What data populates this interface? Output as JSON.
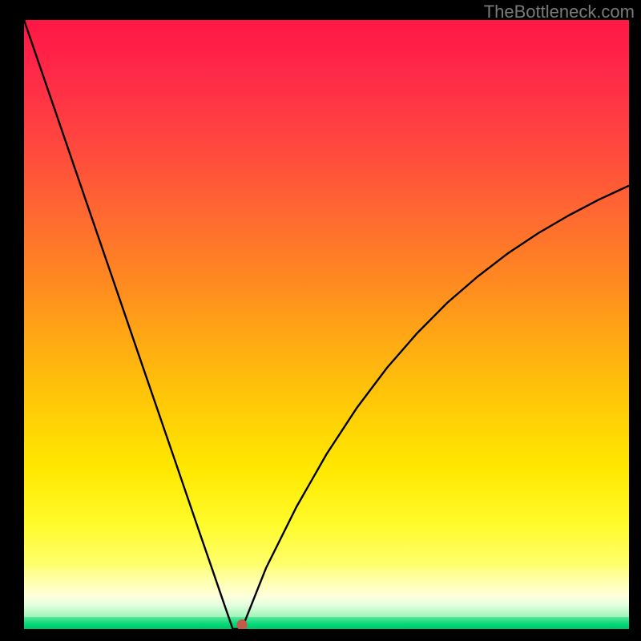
{
  "watermark": "TheBottleneck.com",
  "colors": {
    "frame": "#000000",
    "curve": "#000000",
    "marker": "#c45a4a",
    "watermark": "#7a7a7a"
  },
  "chart_data": {
    "type": "line",
    "title": "",
    "xlabel": "",
    "ylabel": "",
    "xlim": [
      0,
      100
    ],
    "ylim": [
      0,
      100
    ],
    "grid": false,
    "legend": false,
    "annotations": [],
    "background_gradient": {
      "top_color": "#ff1744",
      "description": "vertical red-to-yellow-to-green heat gradient",
      "bottom_color": "#00c46a"
    },
    "series": [
      {
        "name": "bottleneck-curve",
        "x": [
          0,
          5,
          10,
          15,
          20,
          25,
          29,
          31,
          33,
          34.5,
          36,
          40,
          45,
          50,
          55,
          60,
          65,
          70,
          75,
          80,
          85,
          90,
          95,
          100
        ],
        "values": [
          100,
          85.5,
          71,
          56.5,
          42,
          27.5,
          15.9,
          10.1,
          4.3,
          0,
          0,
          10,
          20,
          28.7,
          36.3,
          42.9,
          48.6,
          53.6,
          57.9,
          61.7,
          65,
          67.9,
          70.5,
          72.8
        ]
      }
    ],
    "marker": {
      "x": 36.0,
      "y": 0.6
    }
  }
}
